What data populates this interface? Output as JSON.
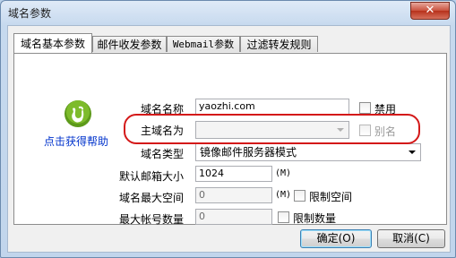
{
  "window": {
    "title": "域名参数",
    "close_symbol": "✕"
  },
  "tabs": [
    {
      "label": "域名基本参数",
      "active": true
    },
    {
      "label": "邮件收发参数",
      "active": false
    },
    {
      "label": "Webmail参数",
      "active": false
    },
    {
      "label": "过滤转发规则",
      "active": false
    }
  ],
  "help": {
    "link_text": "点击获得帮助",
    "icon": "help-logo-icon"
  },
  "fields": {
    "domain_name": {
      "label": "域名名称",
      "value": "yaozhi.com"
    },
    "disable": {
      "label": "禁用",
      "checked": false
    },
    "main_domain": {
      "label": "主域名为",
      "value": ""
    },
    "alias": {
      "label": "别名",
      "checked": false
    },
    "domain_type": {
      "label": "域名类型",
      "value": "镜像邮件服务器模式"
    },
    "default_mailbox_size": {
      "label": "默认邮箱大小",
      "value": "1024",
      "unit": "(M)"
    },
    "max_domain_space": {
      "label": "域名最大空间",
      "value": "0",
      "unit": "(M)"
    },
    "limit_space": {
      "label": "限制空间",
      "checked": false
    },
    "max_accounts": {
      "label": "最大帐号数量",
      "value": "0"
    },
    "limit_count": {
      "label": "限制数量",
      "checked": false
    }
  },
  "buttons": {
    "ok": "确定(O)",
    "cancel": "取消(C)"
  },
  "colors": {
    "highlight": "#d41919",
    "link": "#0033cc",
    "icon_green": "#6aa51c"
  }
}
